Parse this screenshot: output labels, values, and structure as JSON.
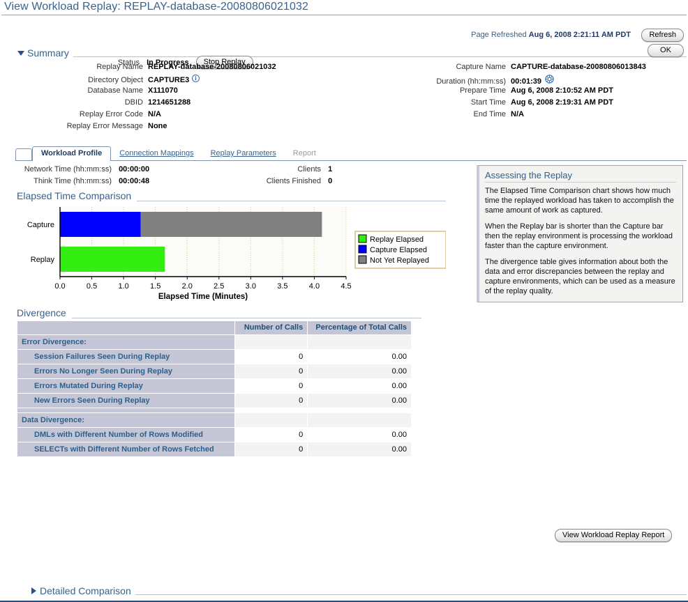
{
  "page": {
    "title": "View Workload Replay: REPLAY-database-20080806021032"
  },
  "header": {
    "page_refreshed_label": "Page Refreshed",
    "page_refreshed_value": "Aug 6, 2008 2:21:11 AM PDT",
    "refresh_button": "Refresh",
    "ok_button": "OK"
  },
  "status": {
    "label": "Status",
    "value": "In Progress",
    "stop_button": "Stop Replay"
  },
  "summary": {
    "title": "Summary",
    "left": [
      {
        "label": "Replay Name",
        "value": "REPLAY-database-20080806021032"
      },
      {
        "label": "Directory Object",
        "value": "CAPTURE3",
        "icon": "info-icon"
      },
      {
        "label": "Database Name",
        "value": "X111070"
      },
      {
        "label": "DBID",
        "value": "1214651288"
      },
      {
        "label": "Replay Error Code",
        "value": "N/A"
      },
      {
        "label": "Replay Error Message",
        "value": "None"
      }
    ],
    "right": [
      {
        "label": "Capture Name",
        "value": "CAPTURE-database-20080806013843"
      },
      {
        "label": "Duration (hh:mm:ss)",
        "value": "00:01:39",
        "icon": "spinner-icon"
      },
      {
        "label": "Prepare Time",
        "value": "Aug 6, 2008 2:10:52 AM PDT"
      },
      {
        "label": "Start Time",
        "value": "Aug 6, 2008 2:19:31 AM PDT"
      },
      {
        "label": "End Time",
        "value": "N/A"
      }
    ]
  },
  "tabs": [
    {
      "label": "Workload Profile",
      "state": "active"
    },
    {
      "label": "Connection Mappings",
      "state": "link"
    },
    {
      "label": "Replay Parameters",
      "state": "link"
    },
    {
      "label": "Report",
      "state": "disabled"
    }
  ],
  "profile": {
    "left": [
      {
        "label": "Network Time (hh:mm:ss)",
        "value": "00:00:00"
      },
      {
        "label": "Think Time (hh:mm:ss)",
        "value": "00:00:48"
      }
    ],
    "right": [
      {
        "label": "Clients",
        "value": "1"
      },
      {
        "label": "Clients Finished",
        "value": "0"
      }
    ]
  },
  "chart_data": {
    "type": "bar",
    "orientation": "horizontal",
    "stacked": true,
    "title": "Elapsed Time Comparison",
    "xlabel": "Elapsed Time (Minutes)",
    "ylabel": "",
    "categories": [
      "Capture",
      "Replay"
    ],
    "xlim": [
      0.0,
      4.5
    ],
    "xticks": [
      0.0,
      0.5,
      1.0,
      1.5,
      2.0,
      2.5,
      3.0,
      3.5,
      4.0,
      4.5
    ],
    "xtick_labels": [
      "0.0",
      "0.5",
      "1.0",
      "1.5",
      "2.0",
      "2.5",
      "3.0",
      "3.5",
      "4.0",
      "4.5"
    ],
    "grid": true,
    "grid_color": "#d8c98a",
    "legend_position": "right",
    "series": [
      {
        "name": "Replay Elapsed",
        "color": "#33ee11",
        "values": [
          0,
          1.65
        ]
      },
      {
        "name": "Capture Elapsed",
        "color": "#0000ff",
        "values": [
          1.27,
          0
        ]
      },
      {
        "name": "Not Yet Replayed",
        "color": "#808080",
        "values": [
          2.85,
          0
        ]
      }
    ],
    "bar_totals": {
      "Capture": 4.12,
      "Replay": 1.65
    }
  },
  "divergence": {
    "title": "Divergence",
    "columns": [
      "",
      "Number of Calls",
      "Percentage of Total Calls"
    ],
    "rows": [
      {
        "kind": "group",
        "label": "Error Divergence:",
        "calls": "",
        "pct": ""
      },
      {
        "kind": "item",
        "label": "Session Failures Seen During Replay",
        "calls": "0",
        "pct": "0.00"
      },
      {
        "kind": "item",
        "label": "Errors No Longer Seen During Replay",
        "calls": "0",
        "pct": "0.00"
      },
      {
        "kind": "item",
        "label": "Errors Mutated During Replay",
        "calls": "0",
        "pct": "0.00"
      },
      {
        "kind": "item",
        "label": "New Errors Seen During Replay",
        "calls": "0",
        "pct": "0.00"
      },
      {
        "kind": "spacer",
        "label": "",
        "calls": "",
        "pct": ""
      },
      {
        "kind": "group",
        "label": "Data Divergence:",
        "calls": "",
        "pct": ""
      },
      {
        "kind": "item",
        "label": "DMLs with Different Number of Rows Modified",
        "calls": "0",
        "pct": "0.00"
      },
      {
        "kind": "item",
        "label": "SELECTs with Different Number of Rows Fetched",
        "calls": "0",
        "pct": "0.00"
      }
    ]
  },
  "side_panel": {
    "title": "Assessing the Replay",
    "paragraphs": [
      "The Elapsed Time Comparison chart shows how much time the replayed workload has taken to accomplish the same amount of work as captured.",
      "When the Replay bar is shorter than the Capture bar then the replay environment is processing the workload faster than the capture environment.",
      "The divergence table gives information about both the data and error discrepancies between the replay and capture environments, which can be used as a measure of the replay quality."
    ],
    "report_button": "View Workload Replay Report"
  },
  "detailed_comparison": {
    "title": "Detailed Comparison"
  },
  "colors": {
    "accent": "#36638f",
    "title_blue": "#1f3a63",
    "table_header_bg": "#c4c6d6",
    "link": "#2d5f8b"
  }
}
